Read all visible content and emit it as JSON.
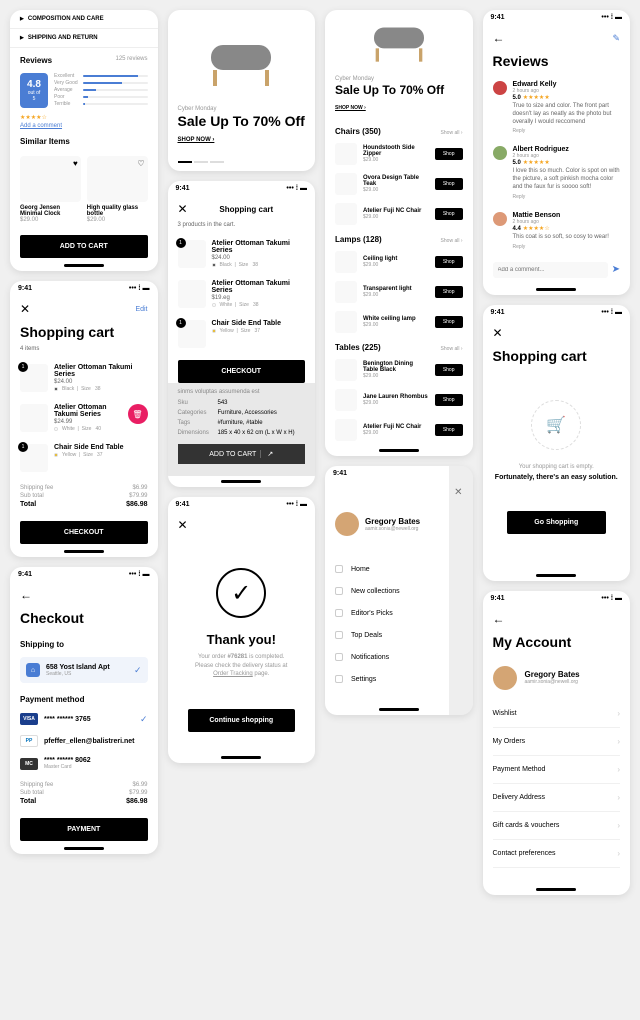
{
  "status": {
    "time": "9:41"
  },
  "pdp": {
    "acc1": "COMPOSITION AND CARE",
    "acc2": "SHIPPING AND RETURN",
    "reviews_title": "Reviews",
    "reviews_count": "125 reviews",
    "rating": "4.8",
    "rating_sub": "out of 5",
    "bars": [
      {
        "label": "Excellent",
        "pct": 85
      },
      {
        "label": "Very Good",
        "pct": 60
      },
      {
        "label": "Average",
        "pct": 20
      },
      {
        "label": "Poor",
        "pct": 8
      },
      {
        "label": "Terrible",
        "pct": 3
      }
    ],
    "stars": "★★★★☆",
    "add_comment": "Add a comment",
    "similar_title": "Similar Items",
    "similar": [
      {
        "name": "Georg Jensen Minimal Clock",
        "price": "$29.00"
      },
      {
        "name": "High quality glass bottle",
        "price": "$29.00"
      }
    ],
    "add_to_cart": "ADD TO CART"
  },
  "cart1": {
    "title": "Shopping cart",
    "edit": "Edit",
    "count": "4 items",
    "items": [
      {
        "qty": "1",
        "name": "Atelier Ottoman Takumi Series",
        "price": "$24.00",
        "color": "#333",
        "colorName": "Black",
        "size": "38"
      },
      {
        "qty": "",
        "name": "Atelier Ottoman Takumi Series",
        "price": "$24.99",
        "color": "#fff",
        "colorName": "White",
        "size": "40",
        "del": true
      },
      {
        "qty": "1",
        "name": "Chair Side End Table",
        "price": "",
        "color": "#eab308",
        "colorName": "Yellow",
        "size": "37"
      }
    ],
    "shipping_label": "Shipping fee",
    "shipping": "$6.99",
    "subtotal_label": "Sub total",
    "subtotal": "$79.99",
    "total_label": "Total",
    "total": "$86.98",
    "checkout": "CHECKOUT"
  },
  "checkout": {
    "title": "Checkout",
    "ship_title": "Shipping to",
    "addr_name": "658 Yost Island Apt",
    "addr_sub": "Seattle, US",
    "pay_title": "Payment method",
    "cards": [
      {
        "type": "VISA",
        "bg": "#1a3e8c",
        "num": "**** ****** 3765",
        "check": true
      },
      {
        "type": "PP",
        "bg": "#fff",
        "num": "pfeffer_ellen@balistreri.net"
      },
      {
        "type": "MC",
        "bg": "#333",
        "num": "**** ****** 8062",
        "sub": "Master Card"
      }
    ],
    "payment": "PAYMENT"
  },
  "hero": {
    "label": "Cyber Monday",
    "title": "Sale Up To 70% Off",
    "shop": "SHOP NOW ›"
  },
  "cart2": {
    "title": "Shopping cart",
    "meta": "3 products in the cart.",
    "items": [
      {
        "qty": "1",
        "name": "Atelier Ottoman Takumi Series",
        "price": "$24.00",
        "color": "#333",
        "colorName": "Black",
        "size": "38"
      },
      {
        "qty": "",
        "name": "Atelier Ottoman Takumi Series",
        "price": "$19.eg",
        "color": "#fff",
        "colorName": "White",
        "size": "38"
      },
      {
        "qty": "1",
        "name": "Chair Side End Table",
        "price": "",
        "color": "#eab308",
        "colorName": "Yellow",
        "size": "37"
      }
    ],
    "checkout": "CHECKOUT",
    "info": {
      "desc": "sinms voluptas assumenda est",
      "rows": [
        {
          "l": "Sku",
          "v": "543"
        },
        {
          "l": "Categories",
          "v": "Furniture, Accessories"
        },
        {
          "l": "Tags",
          "v": "#furniture, #table"
        },
        {
          "l": "Dimensions",
          "v": "185 x 40 x 62 cm (L x W x H)"
        }
      ]
    },
    "add": "ADD TO CART"
  },
  "thankyou": {
    "title": "Thank you!",
    "text1": "Your order ",
    "orderno": "#76281",
    "text2": " is completed.",
    "text3": "Please check the delivery status at",
    "link": "Order Tracking",
    "text4": " page.",
    "btn": "Continue shopping"
  },
  "catalog": {
    "hero_label": "Cyber Monday",
    "hero_title": "Sale Up To 70% Off",
    "shop": "SHOP NOW ›",
    "show_all": "Show all ›",
    "shop_btn": "Shop",
    "sections": [
      {
        "title": "Chairs (350)",
        "items": [
          {
            "name": "Houndstooth Side Zipper",
            "price": "$29.00"
          },
          {
            "name": "Ovora Design Table Teak",
            "price": "$29.00"
          },
          {
            "name": "Atelier Fuji NC Chair",
            "price": "$29.00"
          }
        ]
      },
      {
        "title": "Lamps (128)",
        "items": [
          {
            "name": "Ceiling light",
            "price": "$29.00"
          },
          {
            "name": "Transparent light",
            "price": "$29.00"
          },
          {
            "name": "White ceiling lamp",
            "price": "$29.00"
          }
        ]
      },
      {
        "title": "Tables (225)",
        "items": [
          {
            "name": "Benington Dining Table Black",
            "price": "$29.00"
          },
          {
            "name": "Jane Lauren Rhombus",
            "price": "$29.00"
          },
          {
            "name": "Atelier Fuji NC Chair",
            "price": "$29.00"
          }
        ]
      }
    ]
  },
  "menu": {
    "user_name": "Gregory Bates",
    "user_email": "aamir.sonia@newell.org",
    "items": [
      "Home",
      "New collections",
      "Editor's Picks",
      "Top Deals",
      "Notifications",
      "Settings"
    ]
  },
  "reviews": {
    "title": "Reviews",
    "items": [
      {
        "name": "Edward Kelly",
        "time": "2 hours ago",
        "rating": "5.0",
        "stars": "★★★★★",
        "text": "True to size and color. The front part doesn't lay as neatly as the photo but overally I would reccomend",
        "color": "#c44"
      },
      {
        "name": "Albert Rodriguez",
        "time": "2 hours ago",
        "rating": "5.0",
        "stars": "★★★★★",
        "text": "I love this so much. Color is spot on with the picture, a soft pinkish mocha color and the faux fur is soooo soft!",
        "color": "#8a6"
      },
      {
        "name": "Mattie Benson",
        "time": "2 hours ago",
        "rating": "4.4",
        "stars": "★★★★☆",
        "text": "This coat is so soft, so cosy to wear!",
        "color": "#d97"
      }
    ],
    "reply": "Reply",
    "placeholder": "Add a comment..."
  },
  "empty_cart": {
    "title": "Shopping cart",
    "msg": "Your shopping cart is empty.",
    "sub": "Fortunately, there's an easy solution.",
    "btn": "Go Shopping"
  },
  "account": {
    "title": "My Account",
    "user_name": "Gregory Bates",
    "user_email": "aamir.sonia@newell.org",
    "items": [
      "Wishlist",
      "My Orders",
      "Payment Method",
      "Delivery Address",
      "Gift cards & vouchers",
      "Contact preferences"
    ]
  }
}
